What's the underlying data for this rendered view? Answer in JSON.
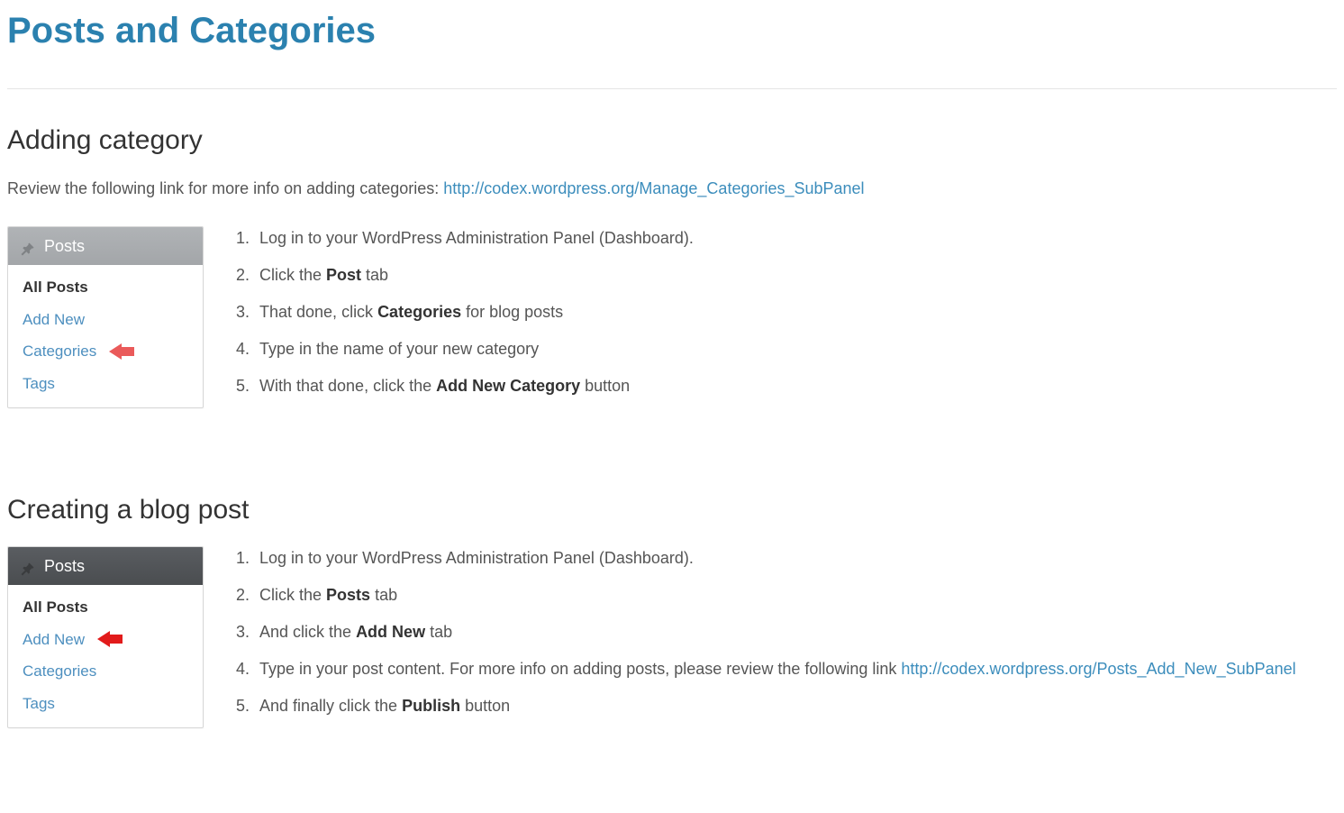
{
  "title": "Posts and Categories",
  "section1": {
    "heading": "Adding category",
    "intro_prefix": "Review the following link for more info on adding categories: ",
    "intro_link_text": "http://codex.wordpress.org/Manage_Categories_SubPanel",
    "sidebar_title": "Posts",
    "items": {
      "all_posts": "All Posts",
      "add_new": "Add New",
      "categories": "Categories",
      "tags": "Tags"
    },
    "steps": {
      "s1": "Log in to your WordPress Administration Panel (Dashboard).",
      "s2a": "Click the ",
      "s2b": "Post",
      "s2c": " tab",
      "s3a": "That done, click ",
      "s3b": "Categories",
      "s3c": " for blog posts",
      "s4": "Type in the name of your new category",
      "s5a": "With that done, click the ",
      "s5b": "Add New Category",
      "s5c": " button"
    }
  },
  "section2": {
    "heading": "Creating a blog post",
    "sidebar_title": "Posts",
    "items": {
      "all_posts": "All Posts",
      "add_new": "Add New",
      "categories": "Categories",
      "tags": "Tags"
    },
    "steps": {
      "s1": "Log in to your WordPress Administration Panel (Dashboard).",
      "s2a": "Click the ",
      "s2b": "Posts",
      "s2c": " tab",
      "s3a": "And click the ",
      "s3b": "Add New",
      "s3c": " tab",
      "s4a": "Type in your post content. For more info on adding posts, please review the following link ",
      "s4_link": "http://codex.wordpress.org/Posts_Add_New_SubPanel",
      "s5a": "And finally click the ",
      "s5b": "Publish",
      "s5c": " button"
    }
  }
}
